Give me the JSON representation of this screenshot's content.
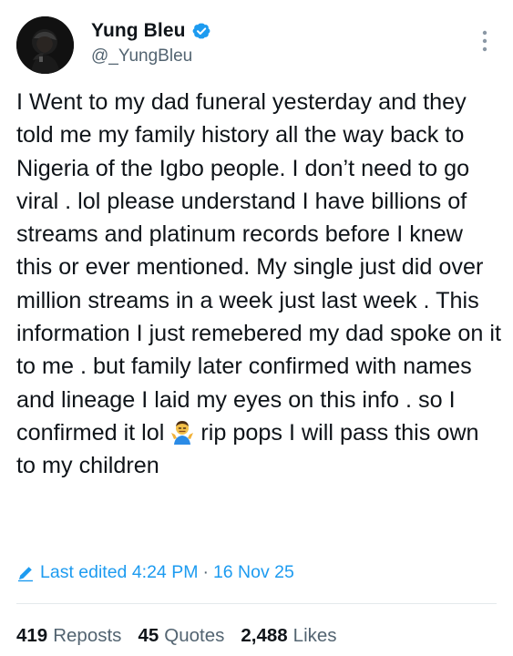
{
  "author": {
    "display_name": "Yung Bleu",
    "handle": "@_YungBleu",
    "verified": true,
    "avatar_icon": "avatar-photo-icon"
  },
  "tweet": {
    "text_before_emoji": "I Went to my dad funeral yesterday and they told me my family history all the way back to Nigeria of the Igbo people. I don’t need to go viral . lol please understand I have billions of streams and platinum records before I knew this or ever mentioned. My single just did over million streams in a week just last week . This information I just remebered my dad spoke on it to me . but family later confirmed with names and lineage I laid my eyes on this info . so I confirmed it lol ",
    "emoji": "man-shrugging-emoji",
    "text_after_emoji": " rip pops I will pass this own to my children"
  },
  "edited": {
    "label": "Last edited 4:24 PM",
    "separator": "·",
    "date": "16 Nov 25"
  },
  "stats": [
    {
      "count": "419",
      "label": "Reposts"
    },
    {
      "count": "45",
      "label": "Quotes"
    },
    {
      "count": "2,488",
      "label": "Likes"
    }
  ],
  "colors": {
    "accent": "#1d9bf0",
    "text": "#0f1419",
    "secondary": "#536471",
    "divider": "#e4e9ec"
  }
}
